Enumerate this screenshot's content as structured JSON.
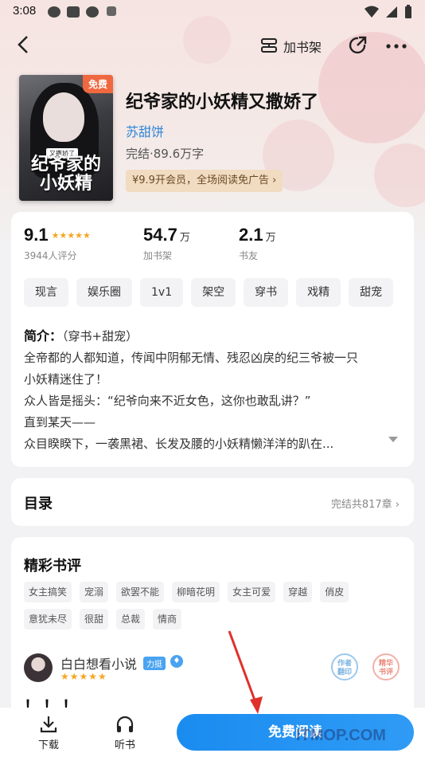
{
  "status_bar": {
    "time": "3:08"
  },
  "nav": {
    "add_shelf_label": "加书架"
  },
  "book": {
    "cover_tag": "免费",
    "cover_title": "纪爷家的小妖精",
    "cover_subtitle": "又撒娇了",
    "title": "纪爷家的小妖精又撒娇了",
    "author": "苏甜饼",
    "status": "完结·89.6万字",
    "vip_promo": "¥9.9开会员，全场阅读免广告 ›"
  },
  "stats": [
    {
      "value": "9.1",
      "unit": "",
      "label": "3944人评分",
      "stars": 4.5
    },
    {
      "value": "54.7",
      "unit": "万",
      "label": "加书架"
    },
    {
      "value": "2.1",
      "unit": "万",
      "label": "书友"
    }
  ],
  "tags": [
    "现言",
    "娱乐圈",
    "1v1",
    "架空",
    "穿书",
    "戏精",
    "甜宠"
  ],
  "intro": {
    "heading": "简介：",
    "first": "（穿书+甜宠）",
    "lines": [
      "全帝都的人都知道，传闻中阴郁无情、残忍凶戾的纪三爷被一只",
      "小妖精迷住了！",
      "众人皆是摇头：“纪爷向来不近女色，这你也敢乱讲？”",
      "直到某天——",
      "众目睽睽下，一袭黑裙、长发及腰的小妖精懒洋洋的趴在..."
    ]
  },
  "toc": {
    "title": "目录",
    "meta": "完结共817章 ›"
  },
  "reviews": {
    "title": "精彩书评",
    "tags": [
      "女主搞笑",
      "宠溺",
      "欲罢不能",
      "柳暗花明",
      "女主可爱",
      "穿越",
      "俏皮",
      "意犹未尽",
      "很甜",
      "总裁",
      "情商"
    ],
    "user": "白白想看小说",
    "user_badge": "力挺",
    "stamp1": "作者\n翻印",
    "stamp2": "精华\n书评",
    "text": "！！！"
  },
  "bottom": {
    "download": "下载",
    "listen": "听书",
    "read": "免费阅读",
    "watermark": "ITMOP.COM"
  },
  "colors": {
    "accent": "#1a8cf0",
    "author": "#2f86d8",
    "star": "#f5a623",
    "cover_tag": "#f0683f"
  }
}
